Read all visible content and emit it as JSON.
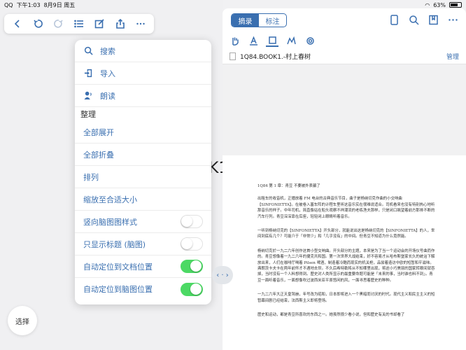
{
  "status_bar": {
    "carrier": "QQ",
    "time": "下午1:03",
    "date": "8月9日 周五",
    "battery": "63%"
  },
  "toolbar": {
    "buttons": [
      "back-icon",
      "undo-icon",
      "redo-icon",
      "list-icon",
      "edit-icon",
      "share-icon",
      "more-icon"
    ]
  },
  "canvas_fragment": "K1",
  "menu": {
    "search": "搜索",
    "import": "导入",
    "read": "朗读",
    "section_organize": "整理",
    "expand_all": "全部展开",
    "collapse_all": "全部折叠",
    "arrange": "排列",
    "zoom_fit": "缩放至合适大小",
    "vertical_style": "竖向脑图图样式",
    "titles_only": "只显示标题 (脑图)",
    "auto_locate_doc": "自动定位到文档位置",
    "auto_locate_map": "自动定位到脑图位置"
  },
  "toggles": {
    "vertical_style": false,
    "titles_only": false,
    "auto_locate_doc": true,
    "auto_locate_map": true
  },
  "select_button": "选择",
  "drag_handle": "‹ · ›",
  "right_panel": {
    "tab_excerpt": "摘录",
    "tab_annotate": "标注",
    "file_name": "1Q84.BOOK1.-村上春树",
    "manage": "管理"
  },
  "document": {
    "chapter": "1Q84  第 1 章：青豆  不要被外表骗了",
    "p1": "出租车的收音机，正播放着 FM 电台的古典音乐节目，曲子是杨纳切克作曲的小交响曲【SINFONIETTA】。在被卷入塞车阵的计程车里听这音乐实在很难说适合。司机看来也没有特别热心地听那音乐的样子。中年司机，简直像站在船头观察不祥潮流的老练渔夫那样，只是闭口眺望着前方那排不断的汽车行列。青豆深深靠在后座，轻轻闭上眼睛听着音乐。",
    "p2": "一听到杨纳切克的【SINFONIETTA】开头部分，就能说出这是杨纳切克的【SINFONIETTA】的人，世间到底有几个？可能介于「非常少」和「几乎没有」的中间。但青豆不知道为什么竟然能。",
    "p3": "杨纳切克於一九二六年创作这首小型交响曲。开头部分的主题，本来是为了当一个运动会的开场仪号曲而作的。青豆想像着一九二六年的捷克共和国。第一次世界大战结束，好不容易才从哈布斯堡家长久的统治下解放出来，人们在咖啡厅喝着 Pilsen 啤酒，制造着冷酷而现实的机关枪，品尝着造访中欧的短暂和平滋味。弗朗茨卡夫卡在两年前怀才不遇地去世。不久后希特勒将从不知哪里出现，将这小巧美丽的国家转眼间就吞掉，当时没有一个人料想得到。歷史对人类所显示的最重要命题可能是「未来的事，当时谁也料不到」。青豆一面听着音乐，一面想像吹过波西米亚平原悠闲的风，一面寻思着歷史的种种。",
    "p4": "一九二六年大正天皇驾崩，年号改为昭和，日本即将进入一个黑暗而讨厌的时代。现代主义和民主主义的短暂幕间剧已经结束，法西斯主义即将登场。",
    "p5": "歷史和运动，都是青豆所喜欢的东西之一。她虽然很少看小说，但和歷史有关的书却看了"
  }
}
